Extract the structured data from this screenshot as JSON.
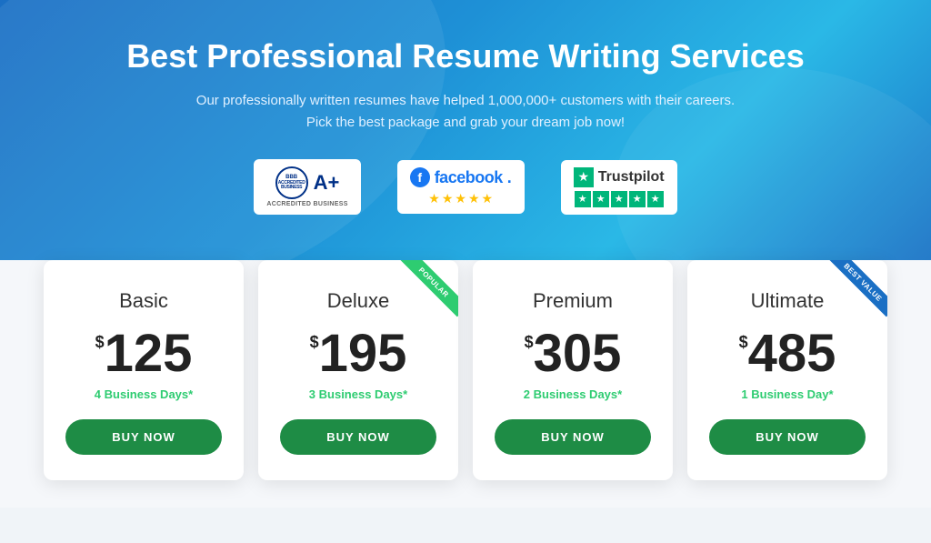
{
  "hero": {
    "title": "Best Professional Resume Writing Services",
    "subtitle_line1": "Our professionally written resumes have helped 1,000,000+ customers with their careers.",
    "subtitle_line2": "Pick the best package and grab your dream job now!"
  },
  "badges": {
    "bbb": {
      "label_top": "BBB",
      "label_accredited": "ACCREDITED\nBUSINESS",
      "rating": "A+",
      "sub": "ACCREDITED BUSINESS"
    },
    "facebook": {
      "label": "facebook.",
      "stars": [
        "★",
        "★",
        "★",
        "★",
        "★"
      ]
    },
    "trustpilot": {
      "label": "Trustpilot",
      "stars": [
        "★",
        "★",
        "★",
        "★",
        "★"
      ]
    }
  },
  "pricing": {
    "cards": [
      {
        "id": "basic",
        "name": "Basic",
        "badge": null,
        "currency": "$",
        "price": "125",
        "delivery": "4 Business Days*",
        "buy_label": "BUY NOW"
      },
      {
        "id": "deluxe",
        "name": "Deluxe",
        "badge": "POPULAR",
        "badge_type": "popular",
        "currency": "$",
        "price": "195",
        "delivery": "3 Business Days*",
        "buy_label": "BUY NOW"
      },
      {
        "id": "premium",
        "name": "Premium",
        "badge": null,
        "currency": "$",
        "price": "305",
        "delivery": "2 Business Days*",
        "buy_label": "BUY NOW"
      },
      {
        "id": "ultimate",
        "name": "Ultimate",
        "badge": "BEST VALUE",
        "badge_type": "best-value",
        "currency": "$",
        "price": "485",
        "delivery": "1 Business Day*",
        "buy_label": "BUY NOW"
      }
    ]
  }
}
